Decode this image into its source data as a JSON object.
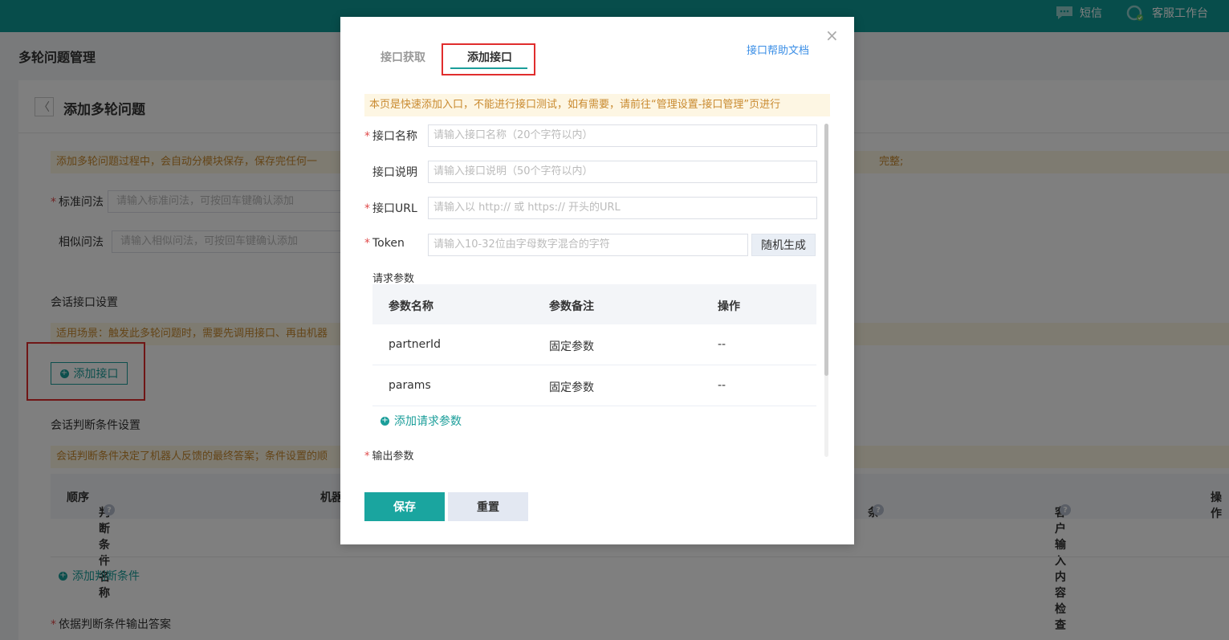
{
  "topbar": {
    "sms_label": "短信",
    "workbench_label": "客服工作台"
  },
  "page": {
    "title": "多轮问题管理",
    "subtitle": "添加多轮问题",
    "back_glyph": "〈",
    "autosave_notice": "添加多轮问题过程中，会自动分模块保存，保存完任何一",
    "autosave_notice_tail": "完整;",
    "std_question_label": "标准问法",
    "std_question_placeholder": "请输入标准问法，可按回车键确认添加",
    "similar_question_label": "相似问法",
    "similar_question_placeholder": "请输入相似问法，可按回车键确认添加",
    "session_api_section": "会话接口设置",
    "session_api_notice": "适用场景：触发此多轮问题时，需要先调用接口、再由机器",
    "add_api_label": "添加接口",
    "condition_section": "会话判断条件设置",
    "condition_notice": "会话判断条件决定了机器人反馈的最终答案；条件设置的顺",
    "condition_columns": {
      "order": "顺序",
      "name": "判断条件名称",
      "robot": "机器",
      "cond_tail": "条",
      "input_check": "客户输入内容检查",
      "op": "操作"
    },
    "add_condition_label": "添加判断条件",
    "output_answer_label": "依据判断条件输出答案"
  },
  "modal": {
    "tab_fetch": "接口获取",
    "tab_add": "添加接口",
    "help_link": "接口帮助文档",
    "close_glyph": "×",
    "notice": "本页是快速添加入口，不能进行接口测试，如有需要，请前往“管理设置-接口管理”页进行",
    "name_label": "接口名称",
    "name_placeholder": "请输入接口名称（20个字符以内）",
    "desc_label": "接口说明",
    "desc_placeholder": "请输入接口说明（50个字符以内）",
    "url_label": "接口URL",
    "url_placeholder": "请输入以 http:// 或 https:// 开头的URL",
    "token_label": "Token",
    "token_placeholder": "请输入10-32位由字母数字混合的字符",
    "random_button": "随机生成",
    "request_params_label": "请求参数",
    "params_columns": [
      "参数名称",
      "参数备注",
      "操作"
    ],
    "params_rows": [
      [
        "partnerId",
        "固定参数",
        "--"
      ],
      [
        "params",
        "固定参数",
        "--"
      ]
    ],
    "add_param_label": "添加请求参数",
    "output_params_label": "输出参数",
    "save_button": "保存",
    "reset_button": "重置"
  },
  "colors": {
    "brand": "#0f9a96",
    "highlight_box": "#e02d2d",
    "notice_text": "#c98a2f"
  }
}
